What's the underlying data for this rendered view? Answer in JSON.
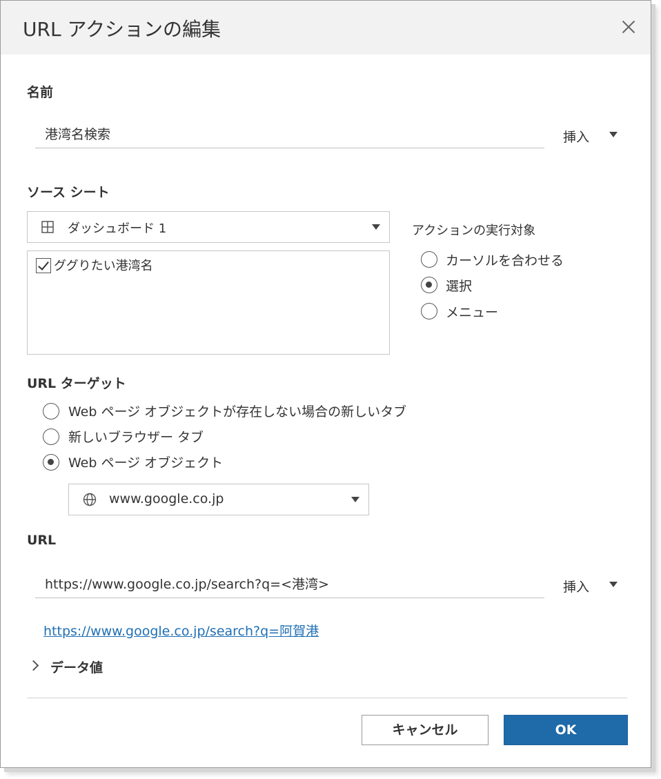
{
  "dialog": {
    "title": "URL アクションの編集"
  },
  "name_section": {
    "label": "名前",
    "value": "港湾名検索",
    "insert_label": "挿入"
  },
  "source_sheet": {
    "label": "ソース シート",
    "selected": "ダッシュボード 1",
    "sheets": [
      {
        "label": "ググりたい港湾名",
        "checked": true
      }
    ]
  },
  "run_action_on": {
    "label": "アクションの実行対象",
    "options": [
      {
        "label": "カーソルを合わせる",
        "selected": false
      },
      {
        "label": "選択",
        "selected": true
      },
      {
        "label": "メニュー",
        "selected": false
      }
    ]
  },
  "url_target": {
    "label": "URL ターゲット",
    "options": [
      {
        "label": "Web ページ オブジェクトが存在しない場合の新しいタブ",
        "selected": false
      },
      {
        "label": "新しいブラウザー タブ",
        "selected": false
      },
      {
        "label": "Web ページ オブジェクト",
        "selected": true
      }
    ],
    "web_object": "www.google.co.jp"
  },
  "url_section": {
    "label": "URL",
    "value": "https://www.google.co.jp/search?q=<港湾>",
    "insert_label": "挿入",
    "preview_link": "https://www.google.co.jp/search?q=阿賀港"
  },
  "data_values": {
    "label": "データ値"
  },
  "footer": {
    "cancel_label": "キャンセル",
    "ok_label": "OK"
  },
  "colors": {
    "primary": "#1f6aa8",
    "link": "#1f6fb5",
    "titlebar": "#f2f2f2"
  },
  "icons": {
    "close": "close-icon",
    "sheet": "grid-icon",
    "web": "globe-icon",
    "expand": "chevron-right-icon",
    "dropdown": "caret-down-icon"
  }
}
